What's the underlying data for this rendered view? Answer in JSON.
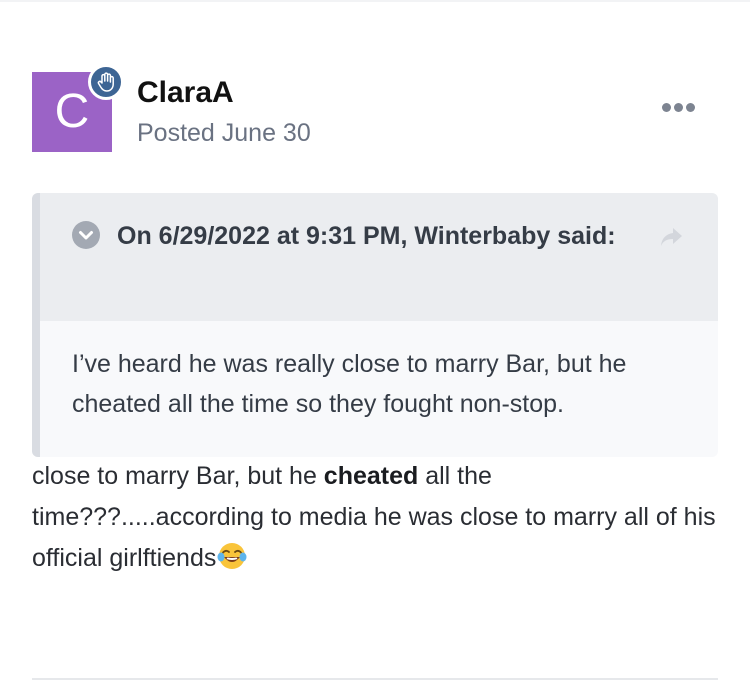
{
  "post": {
    "author": {
      "initial": "C",
      "name": "ClaraA",
      "avatar_color": "#9b63c6",
      "badge_color": "#3d6594",
      "badge_icon": "hand-icon"
    },
    "posted_label": "Posted June 30",
    "menu_icon": "more-dots-icon",
    "quote": {
      "citation": "On 6/29/2022 at 9:31 PM, Winterbaby said:",
      "body": "I’ve heard he was really close to marry Bar, but he cheated all the time so they fought non-stop.",
      "toggle_icon": "chevron-down-circle-icon",
      "share_icon": "share-arrow-icon"
    },
    "reply": {
      "part1": "close to marry Bar, but he ",
      "bold": "cheated",
      "part2": " all the time???.....according to media he was close to marry all of his official girlftiends",
      "emoji_icon": "tears-of-joy-emoji"
    }
  }
}
